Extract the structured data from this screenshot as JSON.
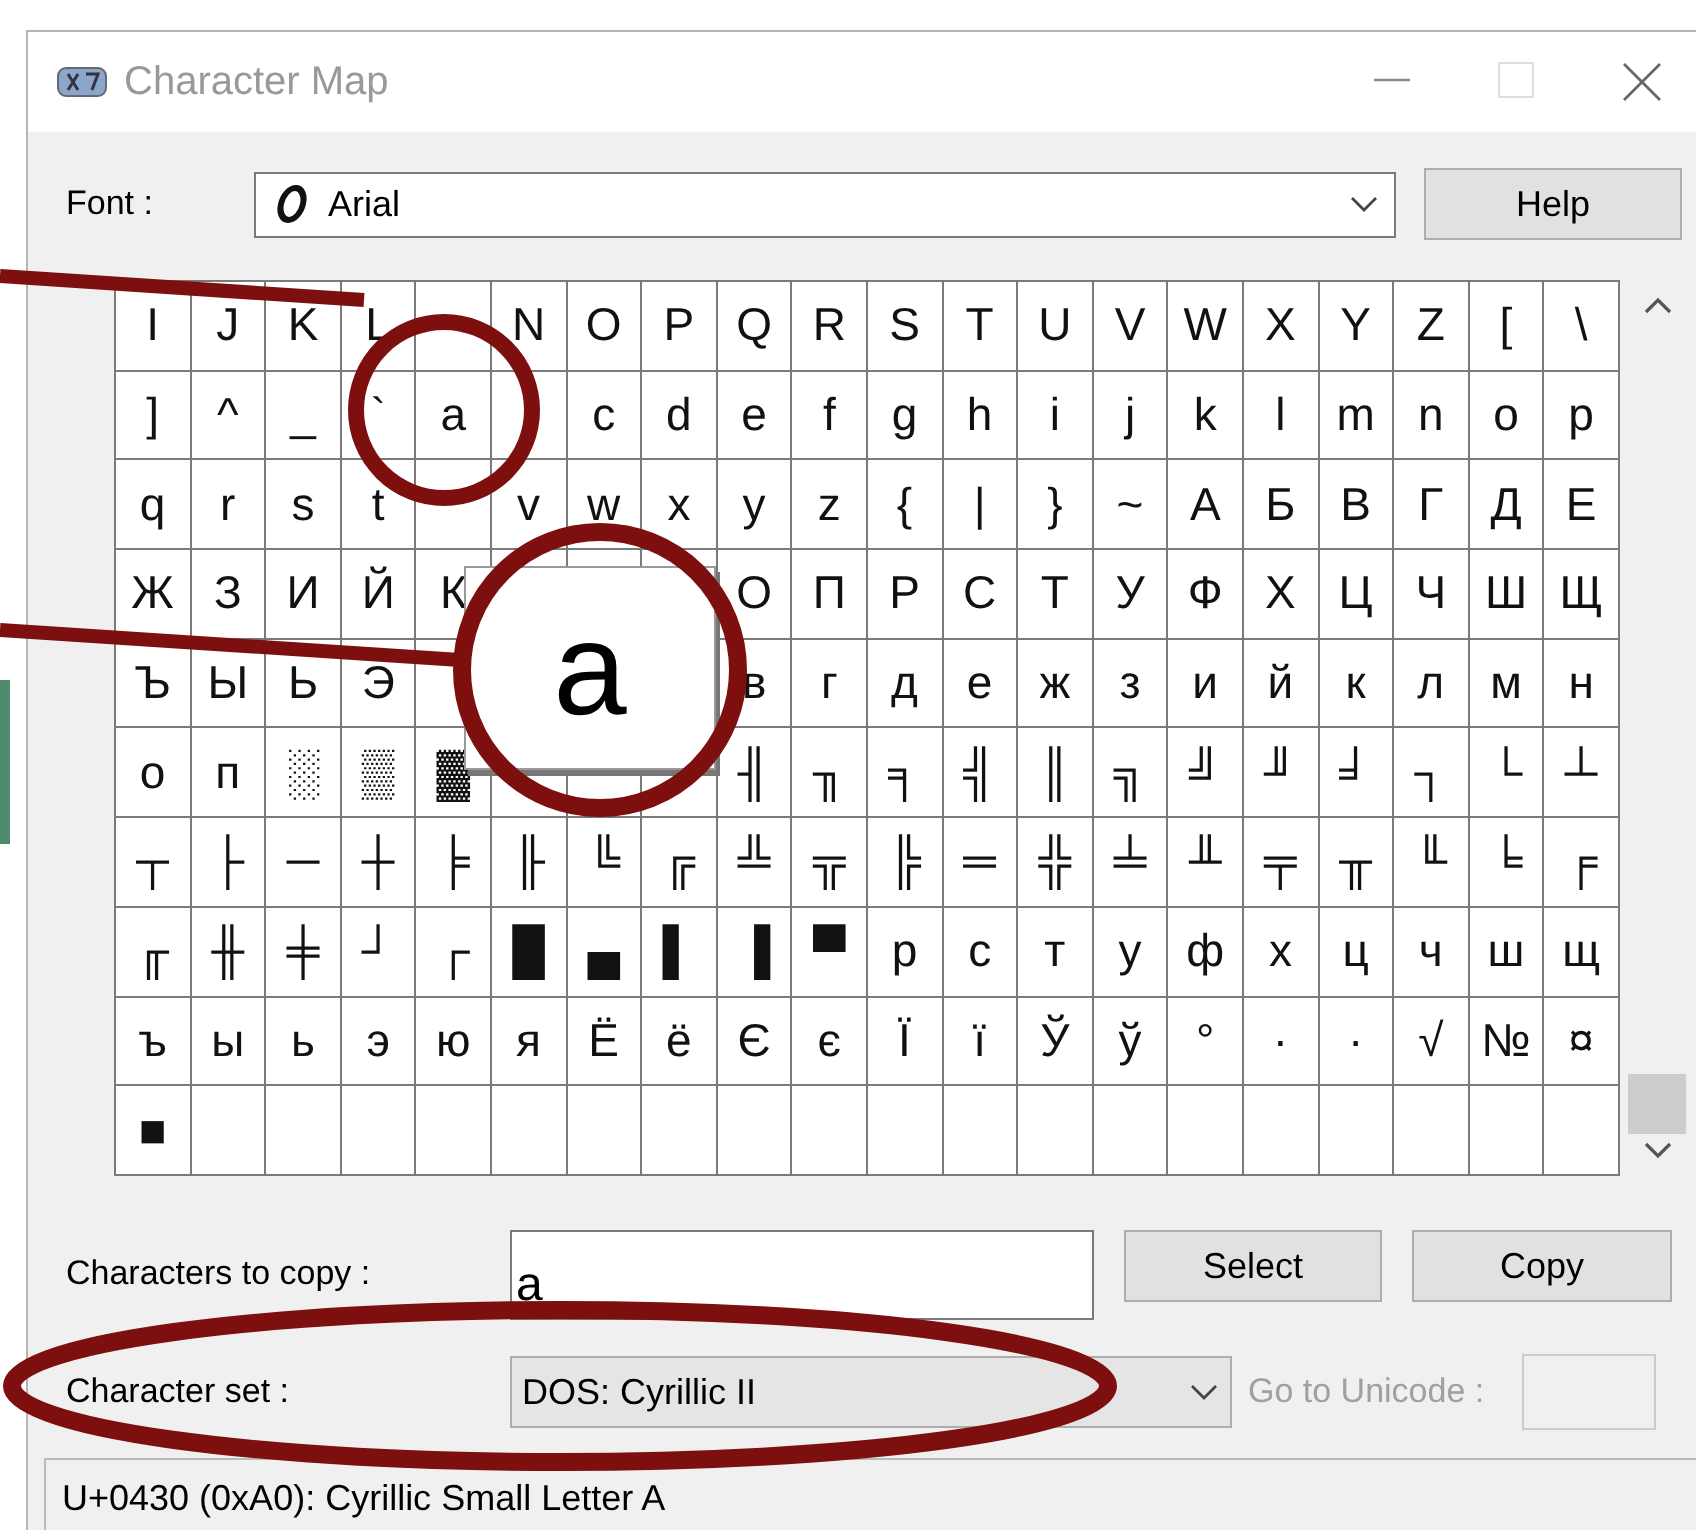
{
  "window": {
    "title": "Character Map"
  },
  "font": {
    "label": "Font :",
    "value": "Arial"
  },
  "help_button": "Help",
  "grid": {
    "rows": [
      [
        "I",
        "J",
        "K",
        "L",
        null,
        "N",
        "O",
        "P",
        "Q",
        "R",
        "S",
        "T",
        "U",
        "V",
        "W",
        "X",
        "Y",
        "Z",
        "[",
        "\\"
      ],
      [
        "]",
        "^",
        "_",
        "`",
        "a",
        null,
        "c",
        "d",
        "e",
        "f",
        "g",
        "h",
        "i",
        "j",
        "k",
        "l",
        "m",
        "n",
        "o",
        "p"
      ],
      [
        "q",
        "r",
        "s",
        "t",
        null,
        "v",
        "w",
        "x",
        "y",
        "z",
        "{",
        "|",
        "}",
        "~",
        "А",
        "Б",
        "В",
        "Г",
        "Д",
        "Е"
      ],
      [
        "Ж",
        "З",
        "И",
        "Й",
        "К",
        null,
        null,
        null,
        "О",
        "П",
        "Р",
        "С",
        "Т",
        "У",
        "Ф",
        "Х",
        "Ц",
        "Ч",
        "Ш",
        "Щ"
      ],
      [
        "Ъ",
        "Ы",
        "Ь",
        "Э",
        null,
        null,
        null,
        null,
        "в",
        "г",
        "д",
        "е",
        "ж",
        "з",
        "и",
        "й",
        "к",
        "л",
        "м",
        "н"
      ],
      [
        "о",
        "п",
        "░",
        "▒",
        "▓",
        null,
        null,
        null,
        "╢",
        "╖",
        "╕",
        "╣",
        "║",
        "╗",
        "╝",
        "╜",
        "╛",
        "┐",
        "└",
        "┴"
      ],
      [
        "┬",
        "├",
        "─",
        "┼",
        "╞",
        "╟",
        "╚",
        "╔",
        "╩",
        "╦",
        "╠",
        "═",
        "╬",
        "╧",
        "╨",
        "╤",
        "╥",
        "╙",
        "╘",
        "╒"
      ],
      [
        "╓",
        "╫",
        "╪",
        "┘",
        "┌",
        "█",
        "▄",
        "▌",
        "▐",
        "▀",
        "р",
        "с",
        "т",
        "у",
        "ф",
        "х",
        "ц",
        "ч",
        "ш",
        "щ"
      ],
      [
        "ъ",
        "ы",
        "ь",
        "э",
        "ю",
        "я",
        "Ё",
        "ё",
        "Є",
        "є",
        "Ї",
        "ї",
        "Ў",
        "ў",
        "°",
        "∙",
        "·",
        "√",
        "№",
        "¤"
      ],
      [
        "■"
      ]
    ]
  },
  "magnifier": {
    "char": "а"
  },
  "copy": {
    "label": "Characters to copy :",
    "value": "а"
  },
  "buttons": [
    "Select",
    "Copy"
  ],
  "character_set": {
    "label": "Character set :",
    "value": "DOS: Cyrillic II"
  },
  "go_to_unicode": {
    "label": "Go to Unicode :",
    "disabled": true
  },
  "status_bar": "U+0430 (0xA0): Cyrillic Small Letter A"
}
